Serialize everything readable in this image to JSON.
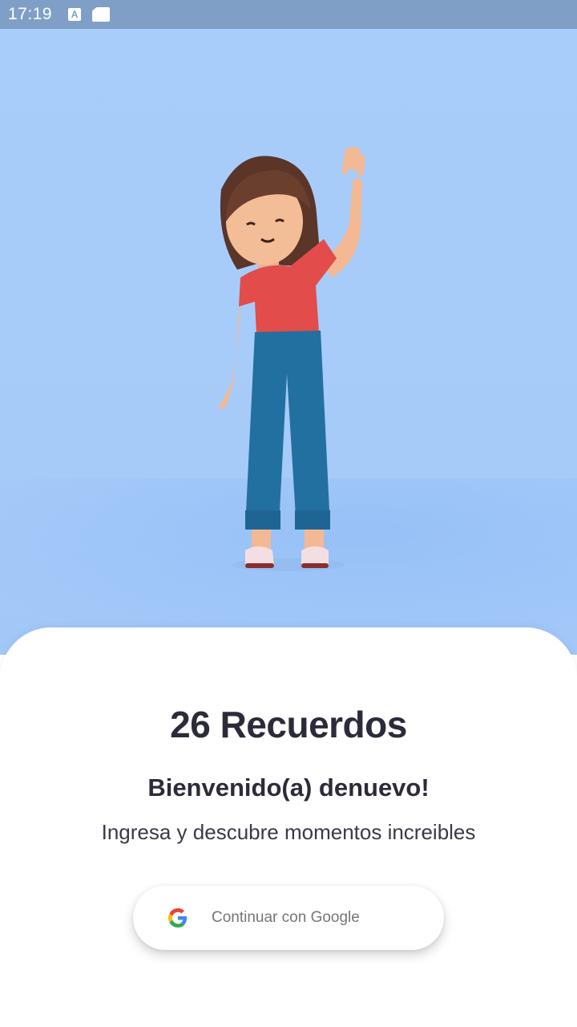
{
  "status_bar": {
    "time": "17:19",
    "icons": [
      "text-a-icon",
      "sd-card-icon"
    ],
    "a_glyph": "A"
  },
  "hero": {
    "illustration": "waving-woman-illustration",
    "background_color": "#a9cdfa"
  },
  "content": {
    "title": "26 Recuerdos",
    "subtitle": "Bienvenido(a) denuevo!",
    "description": "Ingresa y descubre momentos increibles",
    "google_button_label": "Continuar con Google",
    "google_icon": "google-g-icon"
  },
  "colors": {
    "text_dark": "#2c2b3a",
    "button_text": "#757575",
    "status_bar": "#7f9fc7"
  }
}
